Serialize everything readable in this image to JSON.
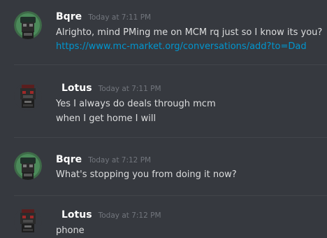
{
  "messages": [
    {
      "username": "Bqre",
      "avatar_icon": "green-circle-avatar-icon",
      "timestamp": "Today at 7:11 PM",
      "lines": [
        "Alrighto, mind PMing me on MCM rq just so I know its you?"
      ],
      "link": "https://www.mc-market.org/conversations/add?to=Dad"
    },
    {
      "username": "Lotus",
      "avatar_icon": "red-skull-avatar-icon",
      "timestamp": "Today at 7:11 PM",
      "lines": [
        "Yes I always do deals through mcm",
        "when I get home I will"
      ]
    },
    {
      "username": "Bqre",
      "avatar_icon": "green-circle-avatar-icon",
      "timestamp": "Today at 7:12 PM",
      "lines": [
        "What's stopping you from doing it now?"
      ]
    },
    {
      "username": "Lotus",
      "avatar_icon": "red-skull-avatar-icon",
      "timestamp": "Today at 7:12 PM",
      "lines": [
        "phone"
      ]
    }
  ],
  "colors": {
    "background": "#36393f",
    "username": "#ffffff",
    "timestamp": "#72767d",
    "message_text": "#dcddde",
    "link": "#0096cf",
    "divider": "#42454a"
  }
}
